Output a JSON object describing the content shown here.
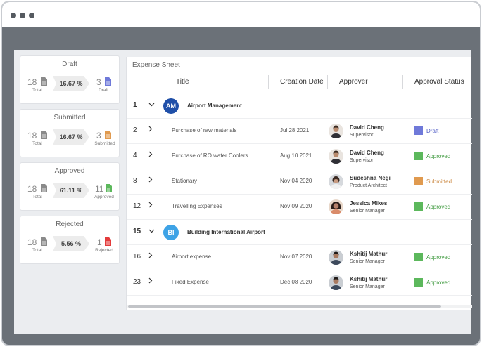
{
  "window": {
    "controls": [
      "dot",
      "dot",
      "dot"
    ]
  },
  "cards": [
    {
      "title": "Draft",
      "total": "18",
      "total_label": "Total",
      "percent": "16.67 %",
      "count": "3",
      "count_label": "Draft",
      "color": "#6f79d9"
    },
    {
      "title": "Submitted",
      "total": "18",
      "total_label": "Total",
      "percent": "16.67 %",
      "count": "3",
      "count_label": "Submitted",
      "color": "#e09a4f"
    },
    {
      "title": "Approved",
      "total": "18",
      "total_label": "Total",
      "percent": "61.11 %",
      "count": "11",
      "count_label": "Approved",
      "color": "#5cb85c"
    },
    {
      "title": "Rejected",
      "total": "18",
      "total_label": "Total",
      "percent": "5.56 %",
      "count": "1",
      "count_label": "Rejected",
      "color": "#e33b3b"
    }
  ],
  "grid": {
    "title": "Expense Sheet",
    "columns": [
      "Title",
      "Creation Date",
      "Approver",
      "Approval Status"
    ],
    "groups": [
      {
        "index": "1",
        "initials": "AM",
        "name": "Airport Management",
        "avatar_color": "#1f4fa8"
      },
      {
        "index": "15",
        "initials": "BI",
        "name": "Building International Airport",
        "avatar_color": "#3ea3e6"
      }
    ],
    "rows": [
      {
        "index": "2",
        "title": "Purchase of raw materials",
        "date": "Jul 28 2021",
        "approver": "David Cheng",
        "role": "Supervisor",
        "status": "Draft",
        "status_color": "#6f79d9",
        "status_text_color": "#4a57c4"
      },
      {
        "index": "4",
        "title": "Purchase of RO water Coolers",
        "date": "Aug 10 2021",
        "approver": "David Cheng",
        "role": "Supervisor",
        "status": "Approved",
        "status_color": "#5cb85c",
        "status_text_color": "#3f9a3f"
      },
      {
        "index": "8",
        "title": "Stationary",
        "date": "Nov 04 2020",
        "approver": "Sudeshna Negi",
        "role": "Product Architect",
        "status": "Submitted",
        "status_color": "#e09a4f",
        "status_text_color": "#cc8a44"
      },
      {
        "index": "12",
        "title": "Travelling Expenses",
        "date": "Nov 09 2020",
        "approver": "Jessica Mikes",
        "role": "Senior Manager",
        "status": "Approved",
        "status_color": "#5cb85c",
        "status_text_color": "#3f9a3f"
      },
      {
        "index": "16",
        "title": "Airport expense",
        "date": "Nov 07 2020",
        "approver": "Kshitij Mathur",
        "role": "Senior Manager",
        "status": "Approved",
        "status_color": "#5cb85c",
        "status_text_color": "#3f9a3f"
      },
      {
        "index": "23",
        "title": "Fixed Expense",
        "date": "Dec 08 2020",
        "approver": "Kshitij Mathur",
        "role": "Senior Manager",
        "status": "Approved",
        "status_color": "#5cb85c",
        "status_text_color": "#3f9a3f"
      }
    ]
  }
}
